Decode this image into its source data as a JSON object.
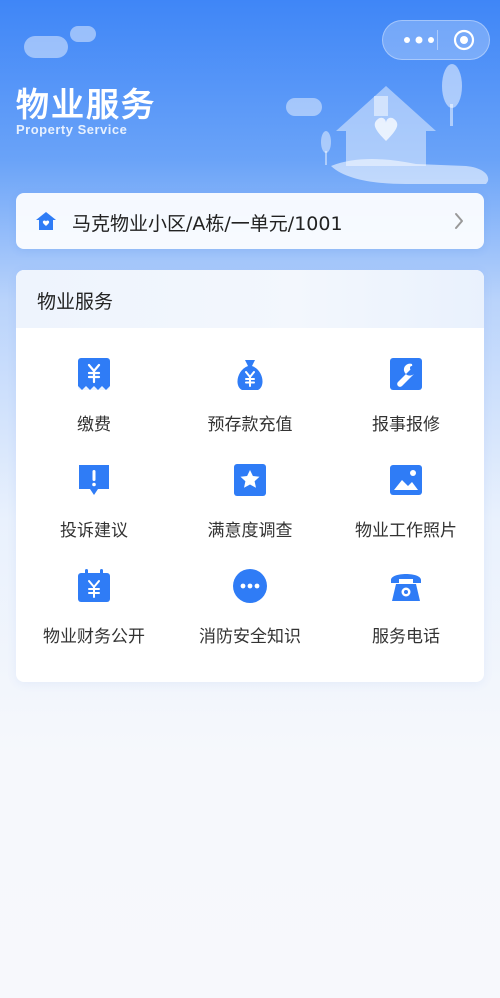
{
  "header": {
    "title": "物业服务",
    "subtitle": "Property Service"
  },
  "address": {
    "text": "马克物业小区/A栋/一单元/1001"
  },
  "panel": {
    "title": "物业服务",
    "services": [
      {
        "label": "缴费",
        "icon": "bill-icon"
      },
      {
        "label": "预存款充值",
        "icon": "money-bag-icon"
      },
      {
        "label": "报事报修",
        "icon": "wrench-icon"
      },
      {
        "label": "投诉建议",
        "icon": "alert-icon"
      },
      {
        "label": "满意度调查",
        "icon": "star-icon"
      },
      {
        "label": "物业工作照片",
        "icon": "photo-icon"
      },
      {
        "label": "物业财务公开",
        "icon": "calendar-yen-icon"
      },
      {
        "label": "消防安全知识",
        "icon": "more-dots-icon"
      },
      {
        "label": "服务电话",
        "icon": "telephone-icon"
      }
    ]
  },
  "colors": {
    "accent": "#2f7cf6",
    "header_top": "#3f86f7"
  }
}
